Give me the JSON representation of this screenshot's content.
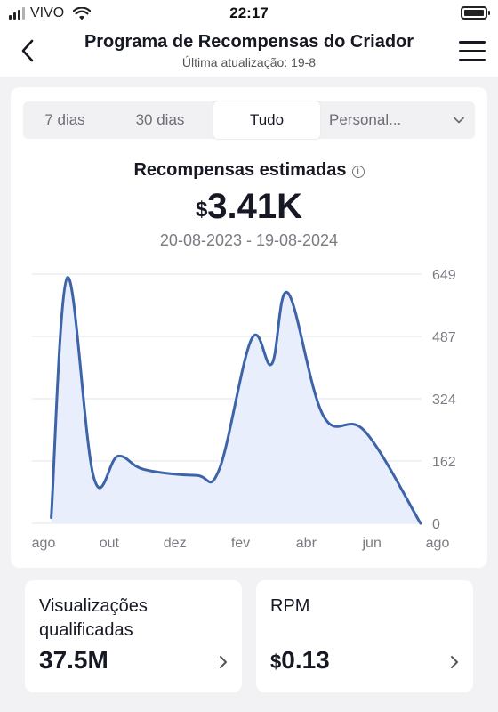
{
  "status_bar": {
    "carrier": "VIVO",
    "time": "22:17"
  },
  "header": {
    "title": "Programa de Recompensas do Criador",
    "subtitle": "Última atualização: 19-8"
  },
  "tabs": {
    "items": [
      "7 dias",
      "30 dias",
      "Tudo"
    ],
    "active": "Tudo",
    "custom": "Personal..."
  },
  "rewards": {
    "title": "Recompensas estimadas",
    "currency": "$",
    "amount": "3.41K",
    "date_range": "20-08-2023 - 19-08-2024"
  },
  "chart_data": {
    "type": "area",
    "x_ticks": [
      "ago",
      "out",
      "dez",
      "fev",
      "abr",
      "jun",
      "ago"
    ],
    "y_ticks": [
      "649",
      "487",
      "324",
      "162",
      "0"
    ],
    "ylim": [
      0,
      649
    ],
    "x": [
      "2023-08-20",
      "2023-09-05",
      "2023-10-01",
      "2023-10-25",
      "2023-11-20",
      "2024-01-10",
      "2024-02-02",
      "2024-03-05",
      "2024-03-25",
      "2024-04-10",
      "2024-05-15",
      "2024-06-25",
      "2024-08-19"
    ],
    "series": [
      {
        "values": [
          15,
          640,
          120,
          175,
          140,
          125,
          140,
          480,
          415,
          600,
          280,
          240,
          0
        ]
      }
    ],
    "grid": true,
    "line_color": "#3d64a8",
    "fill_color": "#e8eefb"
  },
  "stats": {
    "views_label": "Visualizações qualificadas",
    "views_value": "37.5M",
    "rpm_label": "RPM",
    "rpm_currency": "$",
    "rpm_value": "0.13"
  }
}
